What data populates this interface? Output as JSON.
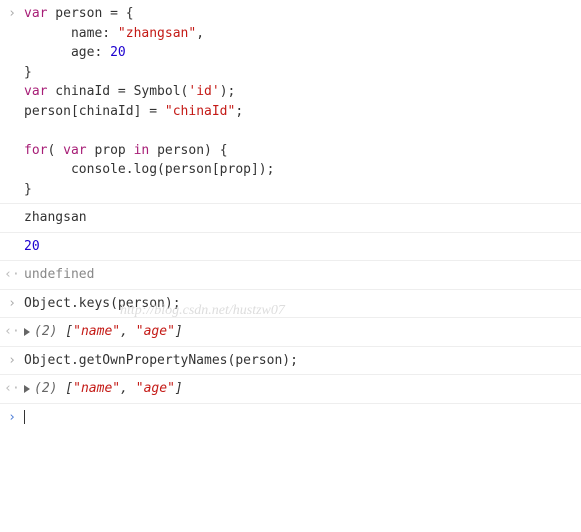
{
  "watermark": "http://blog.csdn.net/hustzw07",
  "entries": [
    {
      "type": "input",
      "gutter": "›",
      "code": {
        "l1a": "var",
        "l1b": " person = {",
        "l2a": "      name: ",
        "l2b": "\"zhangsan\"",
        "l2c": ",",
        "l3a": "      age: ",
        "l3b": "20",
        "l4": "}",
        "l5a": "var",
        "l5b": " chinaId = Symbol(",
        "l5c": "'id'",
        "l5d": ");",
        "l6a": "person[chinaId] = ",
        "l6b": "\"chinaId\"",
        "l6c": ";",
        "l7": "",
        "l8a": "for",
        "l8b": "( ",
        "l8c": "var",
        "l8d": " prop ",
        "l8e": "in",
        "l8f": " person) {",
        "l9": "      console.log(person[prop]);",
        "l10": "}"
      }
    },
    {
      "type": "log",
      "gutter": "",
      "text": "zhangsan"
    },
    {
      "type": "log-num",
      "gutter": "",
      "text": "20"
    },
    {
      "type": "result-undef",
      "gutter": "‹·",
      "text": "undefined"
    },
    {
      "type": "input-simple",
      "gutter": "›",
      "text": "Object.keys(person);"
    },
    {
      "type": "result-array",
      "gutter": "‹·",
      "len": "(2)",
      "open": " [",
      "v1": "\"name\"",
      "sep": ", ",
      "v2": "\"age\"",
      "close": "]"
    },
    {
      "type": "input-simple",
      "gutter": "›",
      "text": "Object.getOwnPropertyNames(person);"
    },
    {
      "type": "result-array",
      "gutter": "‹·",
      "len": "(2)",
      "open": " [",
      "v1": "\"name\"",
      "sep": ", ",
      "v2": "\"age\"",
      "close": "]"
    },
    {
      "type": "prompt",
      "gutter": "›",
      "text": ""
    }
  ]
}
